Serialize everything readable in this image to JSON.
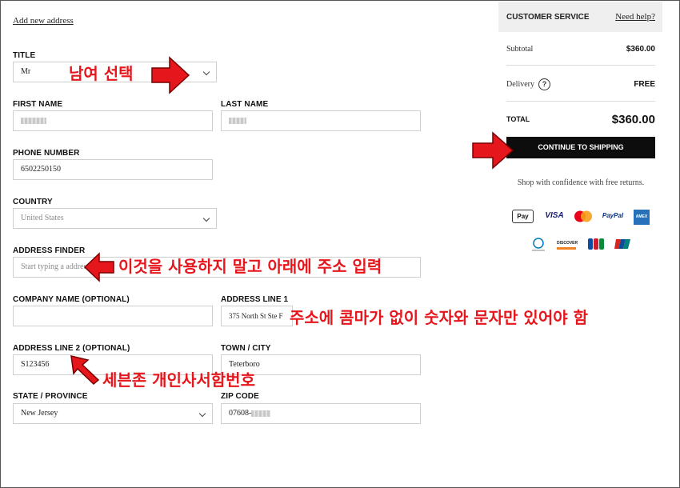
{
  "form": {
    "add_new_address": "Add new address",
    "title": {
      "label": "TITLE",
      "value": "Mr"
    },
    "first_name": {
      "label": "FIRST NAME"
    },
    "last_name": {
      "label": "LAST NAME"
    },
    "phone": {
      "label": "PHONE NUMBER",
      "value": "6502250150"
    },
    "country": {
      "label": "COUNTRY",
      "value": "United States"
    },
    "address_finder": {
      "label": "ADDRESS FINDER",
      "placeholder": "Start typing a address to"
    },
    "company": {
      "label": "COMPANY NAME (OPTIONAL)",
      "value": ""
    },
    "address1": {
      "label": "ADDRESS LINE 1",
      "value": "375 North St Ste F"
    },
    "address2": {
      "label": "ADDRESS LINE 2 (OPTIONAL)",
      "value": "S123456"
    },
    "town": {
      "label": "TOWN / CITY",
      "value": "Teterboro"
    },
    "state": {
      "label": "STATE / PROVINCE",
      "value": "New Jersey"
    },
    "zip": {
      "label": "ZIP CODE",
      "value": "07608-"
    }
  },
  "annotations": {
    "gender_select": "남여 선택",
    "finder_note": "이것을 사용하지 말고 아래에 주소 입력",
    "address_note": "주소에 콤마가 없이 숫자와 문자만 있어야 함",
    "customs_note": "세븐존 개인사서함번호",
    "arrow_color": "#e5161c"
  },
  "summary": {
    "customer_service": "CUSTOMER SERVICE",
    "need_help": "Need help?",
    "subtotal_label": "Subtotal",
    "subtotal_value": "$360.00",
    "delivery_label": "Delivery",
    "delivery_help": "?",
    "delivery_value": "FREE",
    "total_label": "TOTAL",
    "total_value": "$360.00",
    "cta": "CONTINUE TO SHIPPING",
    "confidence": "Shop with confidence with free returns."
  },
  "payments": {
    "applepay": "Pay",
    "visa": "VISA",
    "paypal": "PayPal",
    "amex": "AMEX",
    "discover": "DISCOVER",
    "jcb": "JCB"
  }
}
